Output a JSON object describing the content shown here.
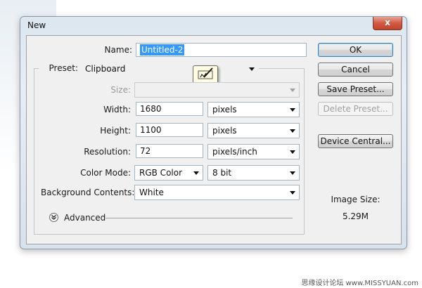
{
  "window": {
    "title": "New",
    "close_glyph": "x"
  },
  "form": {
    "name_label": "Name:",
    "name_value": "Untitled-2",
    "preset_label": "Preset:",
    "preset_value": "Clipboard",
    "size_label": "Size:",
    "size_value": "",
    "width_label": "Width:",
    "width_value": "1680",
    "width_unit": "pixels",
    "height_label": "Height:",
    "height_value": "1100",
    "height_unit": "pixels",
    "resolution_label": "Resolution:",
    "resolution_value": "72",
    "resolution_unit": "pixels/inch",
    "color_mode_label": "Color Mode:",
    "color_mode_value": "RGB Color",
    "bit_depth_value": "8 bit",
    "background_label": "Background Contents:",
    "background_value": "White",
    "advanced_label": "Advanced"
  },
  "buttons": {
    "ok": "OK",
    "cancel": "Cancel",
    "save_preset": "Save Preset...",
    "delete_preset": "Delete Preset...",
    "device_central": "Device Central..."
  },
  "image_size": {
    "label": "Image Size:",
    "value": "5.29M"
  },
  "watermark": "思缘设计论坛  www.MISSYUAN.com",
  "icons": {
    "preset_tooltip": "pen-tablet-icon",
    "advanced_toggle": "chevron-down-circle-icon"
  },
  "colors": {
    "selection": "#3399ff",
    "default_button_border": "#3c7fb1"
  }
}
